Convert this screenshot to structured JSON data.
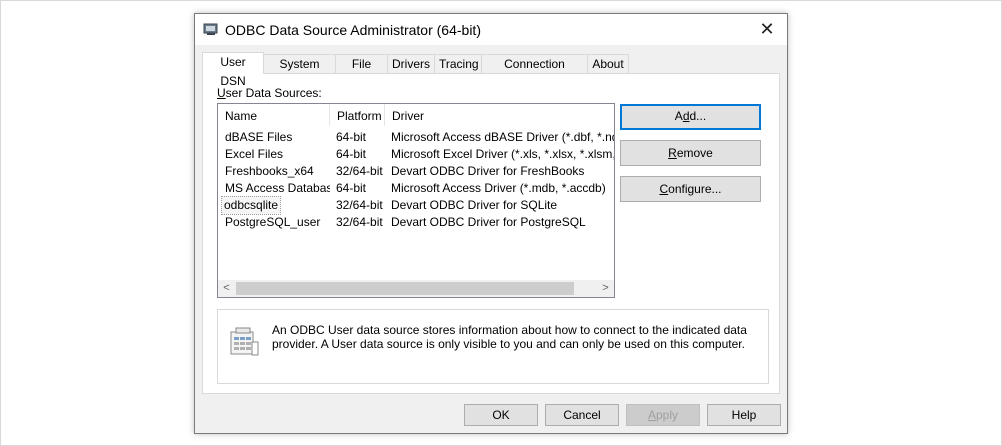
{
  "window": {
    "title": "ODBC Data Source Administrator (64-bit)",
    "close_glyph": "✕"
  },
  "tabs": [
    {
      "label": "User DSN"
    },
    {
      "label": "System DSN"
    },
    {
      "label": "File DSN"
    },
    {
      "label": "Drivers"
    },
    {
      "label": "Tracing"
    },
    {
      "label": "Connection Pooling"
    },
    {
      "label": "About"
    }
  ],
  "panel": {
    "sources_label_underline": "U",
    "sources_label_rest": "ser Data Sources:",
    "columns": [
      "Name",
      "Platform",
      "Driver"
    ],
    "rows": [
      {
        "name": "dBASE Files",
        "platform": "64-bit",
        "driver": "Microsoft Access dBASE Driver (*.dbf, *.ndx, *.mdx)"
      },
      {
        "name": "Excel Files",
        "platform": "64-bit",
        "driver": "Microsoft Excel Driver (*.xls, *.xlsx, *.xlsm, *.xlsb)"
      },
      {
        "name": "Freshbooks_x64",
        "platform": "32/64-bit",
        "driver": "Devart ODBC Driver for FreshBooks"
      },
      {
        "name": "MS Access Database",
        "platform": "64-bit",
        "driver": "Microsoft Access Driver (*.mdb, *.accdb)"
      },
      {
        "name": "odbcsqlite",
        "platform": "32/64-bit",
        "driver": "Devart ODBC Driver for SQLite"
      },
      {
        "name": "PostgreSQL_user",
        "platform": "32/64-bit",
        "driver": "Devart ODBC Driver for PostgreSQL"
      }
    ],
    "scroll_left": "<",
    "scroll_right": ">",
    "buttons": {
      "add": {
        "pre": "A",
        "u": "d",
        "post": "d..."
      },
      "remove": {
        "pre": "",
        "u": "R",
        "post": "emove"
      },
      "configure": {
        "pre": "",
        "u": "C",
        "post": "onfigure..."
      }
    },
    "info_text": "An ODBC User data source stores information about how to connect to the indicated data provider.   A User data source is only visible to you and can only be used on this computer."
  },
  "footer": {
    "ok": "OK",
    "cancel": "Cancel",
    "apply_u": "A",
    "apply_rest": "pply",
    "help": "Help"
  },
  "colors": {
    "default_button_border": "#0078d7",
    "dialog_bg": "#f0f0f0"
  },
  "icons": {
    "title": "odbc-admin-icon",
    "info": "data-source-icon"
  }
}
